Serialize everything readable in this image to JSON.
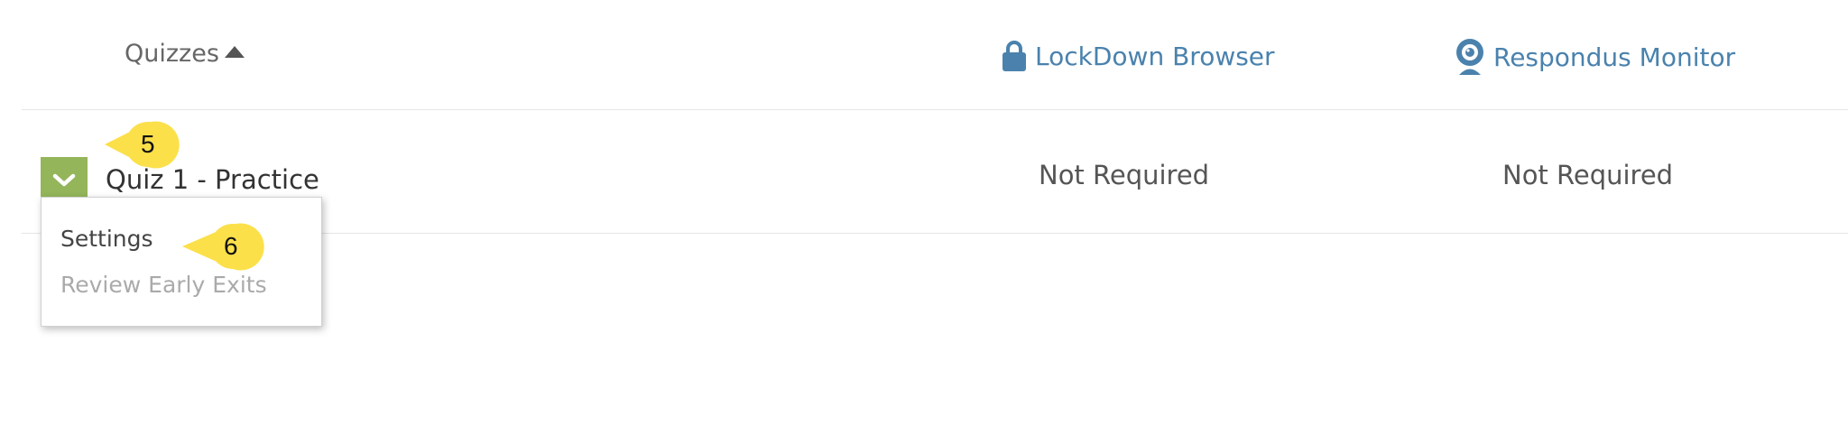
{
  "header": {
    "quizzes_label": "Quizzes",
    "lockdown_label": "LockDown Browser",
    "monitor_label": "Respondus Monitor"
  },
  "quiz": {
    "title": "Quiz 1 - Practice",
    "lockdown_status": "Not Required",
    "monitor_status": "Not Required"
  },
  "menu": {
    "items": [
      "Settings",
      "Review Early Exits"
    ]
  },
  "callouts": [
    "5",
    "6"
  ],
  "colors": {
    "link_blue": "#4a82ad",
    "expand_green": "#94b55a",
    "callout_yellow": "#fbe04a"
  },
  "icons": [
    "sort-up-icon",
    "lock-icon",
    "webcam-icon",
    "chevron-down-icon"
  ]
}
